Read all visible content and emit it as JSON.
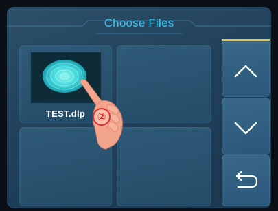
{
  "header": {
    "title": "Choose Files"
  },
  "files": [
    {
      "name": "TEST.dlp"
    },
    {
      "name": ""
    },
    {
      "name": ""
    },
    {
      "name": ""
    }
  ],
  "annotation": {
    "step": "②"
  },
  "icons": {
    "up": "chevron-up-icon",
    "down": "chevron-down-icon",
    "back": "return-icon",
    "pointer": "hand-pointer-icon"
  },
  "colors": {
    "accent": "#38c8f5",
    "panel": "#2f5a78",
    "step_badge": "#e0303a"
  }
}
